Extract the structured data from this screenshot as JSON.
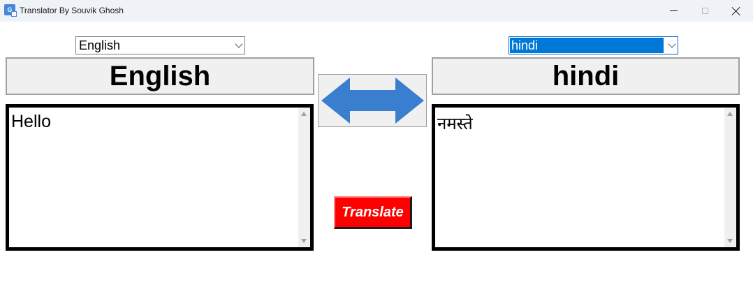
{
  "window": {
    "title": "Translator By Souvik Ghosh",
    "icon": "translate-app-icon"
  },
  "source": {
    "language_select_value": "English",
    "language_label": "English",
    "text": "Hello"
  },
  "target": {
    "language_select_value": "hindi",
    "language_label": "hindi",
    "text": "नमस्ते"
  },
  "controls": {
    "swap_icon": "double-arrow-icon",
    "translate_label": "Translate"
  },
  "colors": {
    "arrow": "#3a7fcf",
    "translate_bg": "#ff0000",
    "selection": "#0078d7",
    "titlebar": "#eff2f7"
  }
}
